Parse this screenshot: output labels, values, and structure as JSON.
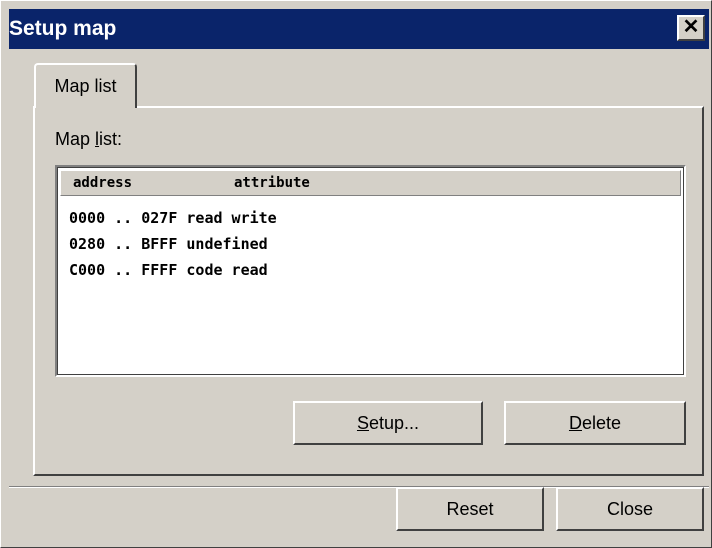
{
  "window": {
    "title": "Setup map",
    "close_glyph": "✕"
  },
  "tabs": [
    {
      "label": "Map list"
    }
  ],
  "panel": {
    "label_prefix": "Map ",
    "label_mnemonic": "l",
    "label_suffix": "ist:"
  },
  "list": {
    "headers": [
      "address",
      "attribute"
    ],
    "rows": [
      {
        "start": "0000",
        "sep": "..",
        "end": "027F",
        "attribute": "read write"
      },
      {
        "start": "0280",
        "sep": "..",
        "end": "BFFF",
        "attribute": "undefined"
      },
      {
        "start": "C000",
        "sep": "..",
        "end": "FFFF",
        "attribute": "code read"
      }
    ]
  },
  "buttons": {
    "setup": {
      "mnemonic": "S",
      "rest": "etup..."
    },
    "delete": {
      "mnemonic": "D",
      "rest": "elete"
    },
    "reset": {
      "label": "Reset"
    },
    "close": {
      "label": "Close"
    }
  },
  "colors": {
    "title_bar": "#0a246a",
    "face": "#d4d0c8"
  }
}
